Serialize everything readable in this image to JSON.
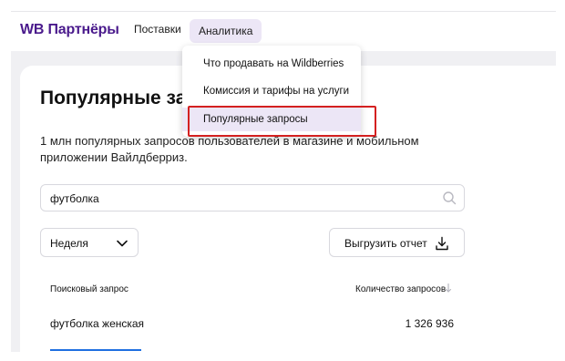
{
  "header": {
    "brand": "WB Партнёры",
    "nav": {
      "supplies": "Поставки",
      "analytics": "Аналитика"
    }
  },
  "dropdown": {
    "items": [
      {
        "label": "Что продавать на Wildberries"
      },
      {
        "label": "Комиссия и тарифы на услуги"
      },
      {
        "label": "Популярные запросы",
        "active": true
      }
    ]
  },
  "main": {
    "title": "Популярные запросы",
    "description": "1 млн популярных запросов пользователей в магазине и мобильном приложении Вайлдберриз.",
    "search": {
      "value": "футболка",
      "icon": "search-icon"
    },
    "period_select": {
      "value": "Неделя",
      "icon": "chevron-down-icon"
    },
    "export_button": {
      "label": "Выгрузить отчет",
      "icon": "download-icon"
    },
    "table": {
      "columns": [
        "Поисковый запрос",
        "Количество запросов"
      ],
      "rows": [
        {
          "query": "футболка женская",
          "count": "1 326 936"
        }
      ]
    }
  },
  "colors": {
    "brand": "#4a1a8c",
    "highlight_bg": "#ece6f6",
    "annotation_red": "#d42020",
    "accent_blue": "#1f6fe0"
  }
}
